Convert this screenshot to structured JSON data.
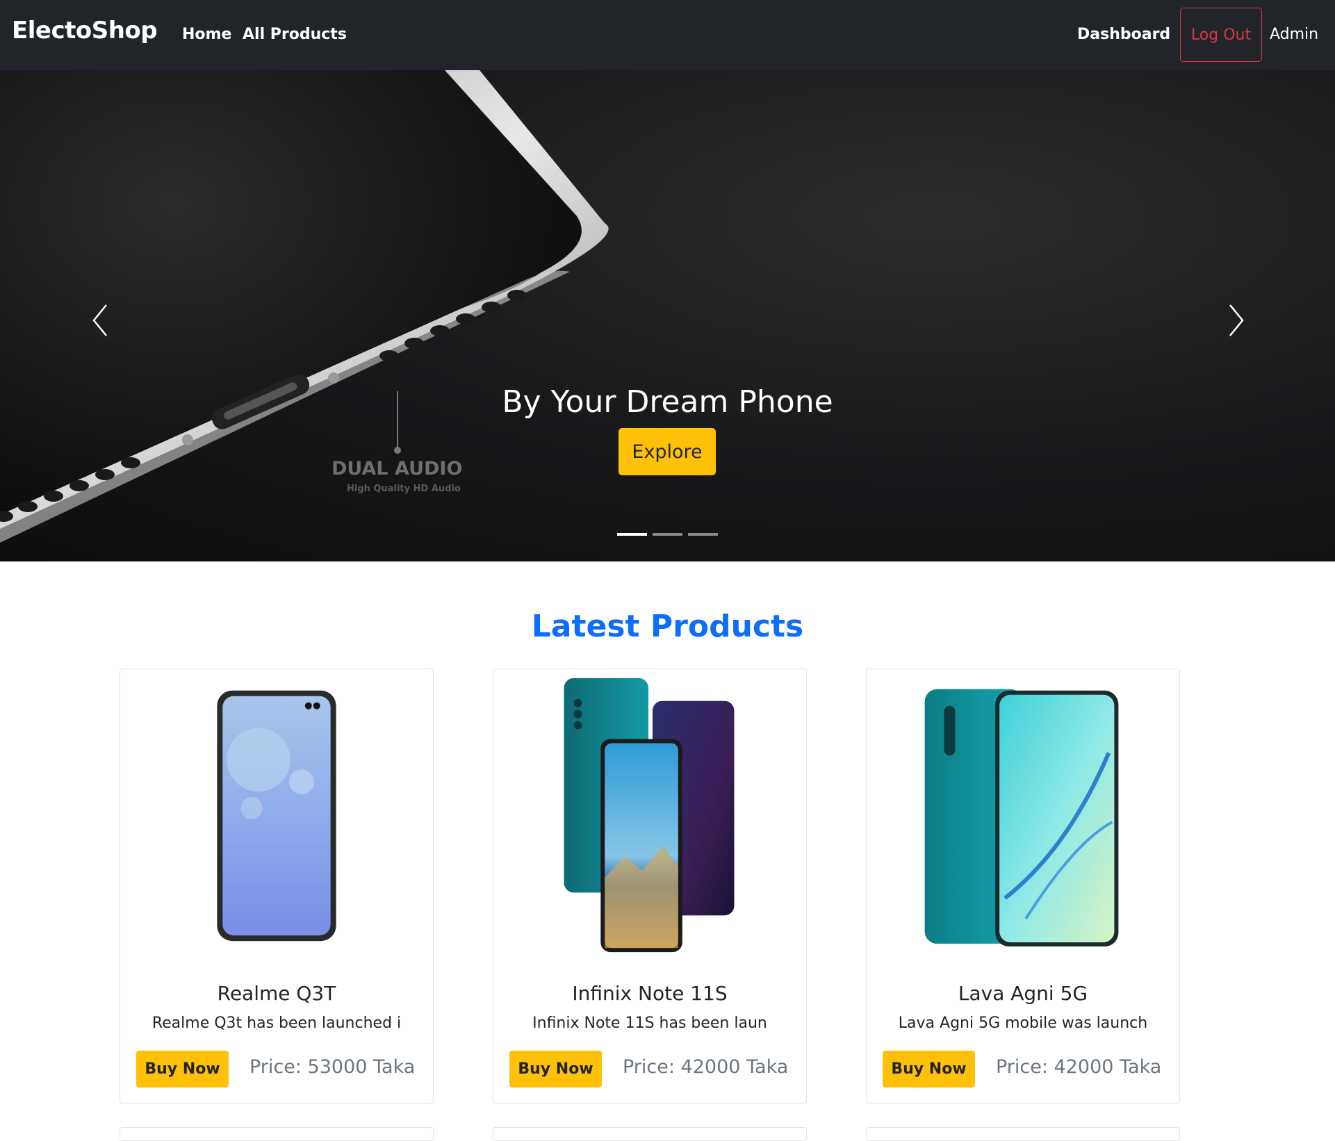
{
  "navbar": {
    "brand": "ElectoShop",
    "links": [
      "Home",
      "All Products"
    ],
    "dashboard": "Dashboard",
    "logout": "Log Out",
    "user": "Admin"
  },
  "hero": {
    "title": "By Your Dream Phone",
    "button": "Explore",
    "image_text": "DUAL AUDIO",
    "image_subtext": "High Quality HD Audio",
    "slides": 3,
    "active_slide": 1
  },
  "section": {
    "title": "Latest Products"
  },
  "products": [
    {
      "name": "Realme Q3T",
      "desc": "Realme Q3t has been launched i",
      "button": "Buy Now",
      "price": "Price: 53000 Taka"
    },
    {
      "name": "Infinix Note 11S",
      "desc": "Infinix Note 11S has been laun",
      "button": "Buy Now",
      "price": "Price: 42000 Taka"
    },
    {
      "name": "Lava Agni 5G",
      "desc": "Lava Agni 5G mobile was launch",
      "button": "Buy Now",
      "price": "Price: 42000 Taka"
    }
  ],
  "colors": {
    "navbar": "#212529",
    "accent_yellow": "#ffc107",
    "heading_blue": "#0d6efd",
    "danger": "#dc3545"
  }
}
